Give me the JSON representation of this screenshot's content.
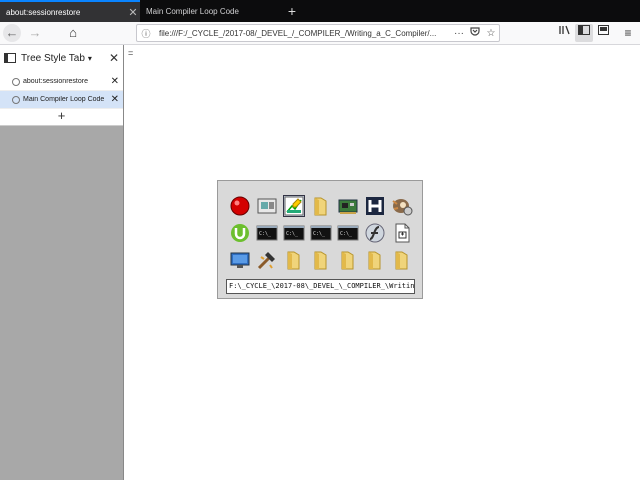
{
  "tabs": [
    {
      "title": "about:sessionrestore",
      "active": true
    },
    {
      "title": "Main Compiler Loop Code",
      "active": false
    }
  ],
  "nav": {
    "url": "file:///F:/_CYCLE_/2017-08/_DEVEL_/_COMPILER_/Writing_a_C_Compiler/..."
  },
  "sidebar": {
    "title": "Tree Style Tab",
    "items": [
      {
        "title": "about:sessionrestore",
        "selected": false
      },
      {
        "title": "Main Compiler Loop Code",
        "selected": true
      }
    ]
  },
  "content": {
    "marker": "="
  },
  "launcher": {
    "path": "F:\\_CYCLE_\\2017-08\\_DEVEL_\\_COMPILER_\\Writin...",
    "icons": [
      [
        "record-icon",
        "window-app-icon",
        "chart-app-icon",
        "folder-icon",
        "network-card-icon",
        "h-app-icon",
        "gimp-icon"
      ],
      [
        "utorrent-icon",
        "terminal-icon",
        "terminal-icon",
        "terminal-icon",
        "terminal-icon",
        "flash-icon",
        "document-icon"
      ],
      [
        "monitor-icon",
        "hammer-tool-icon",
        "folder-icon",
        "folder-icon",
        "folder-icon",
        "folder-icon",
        "folder-icon"
      ]
    ]
  }
}
